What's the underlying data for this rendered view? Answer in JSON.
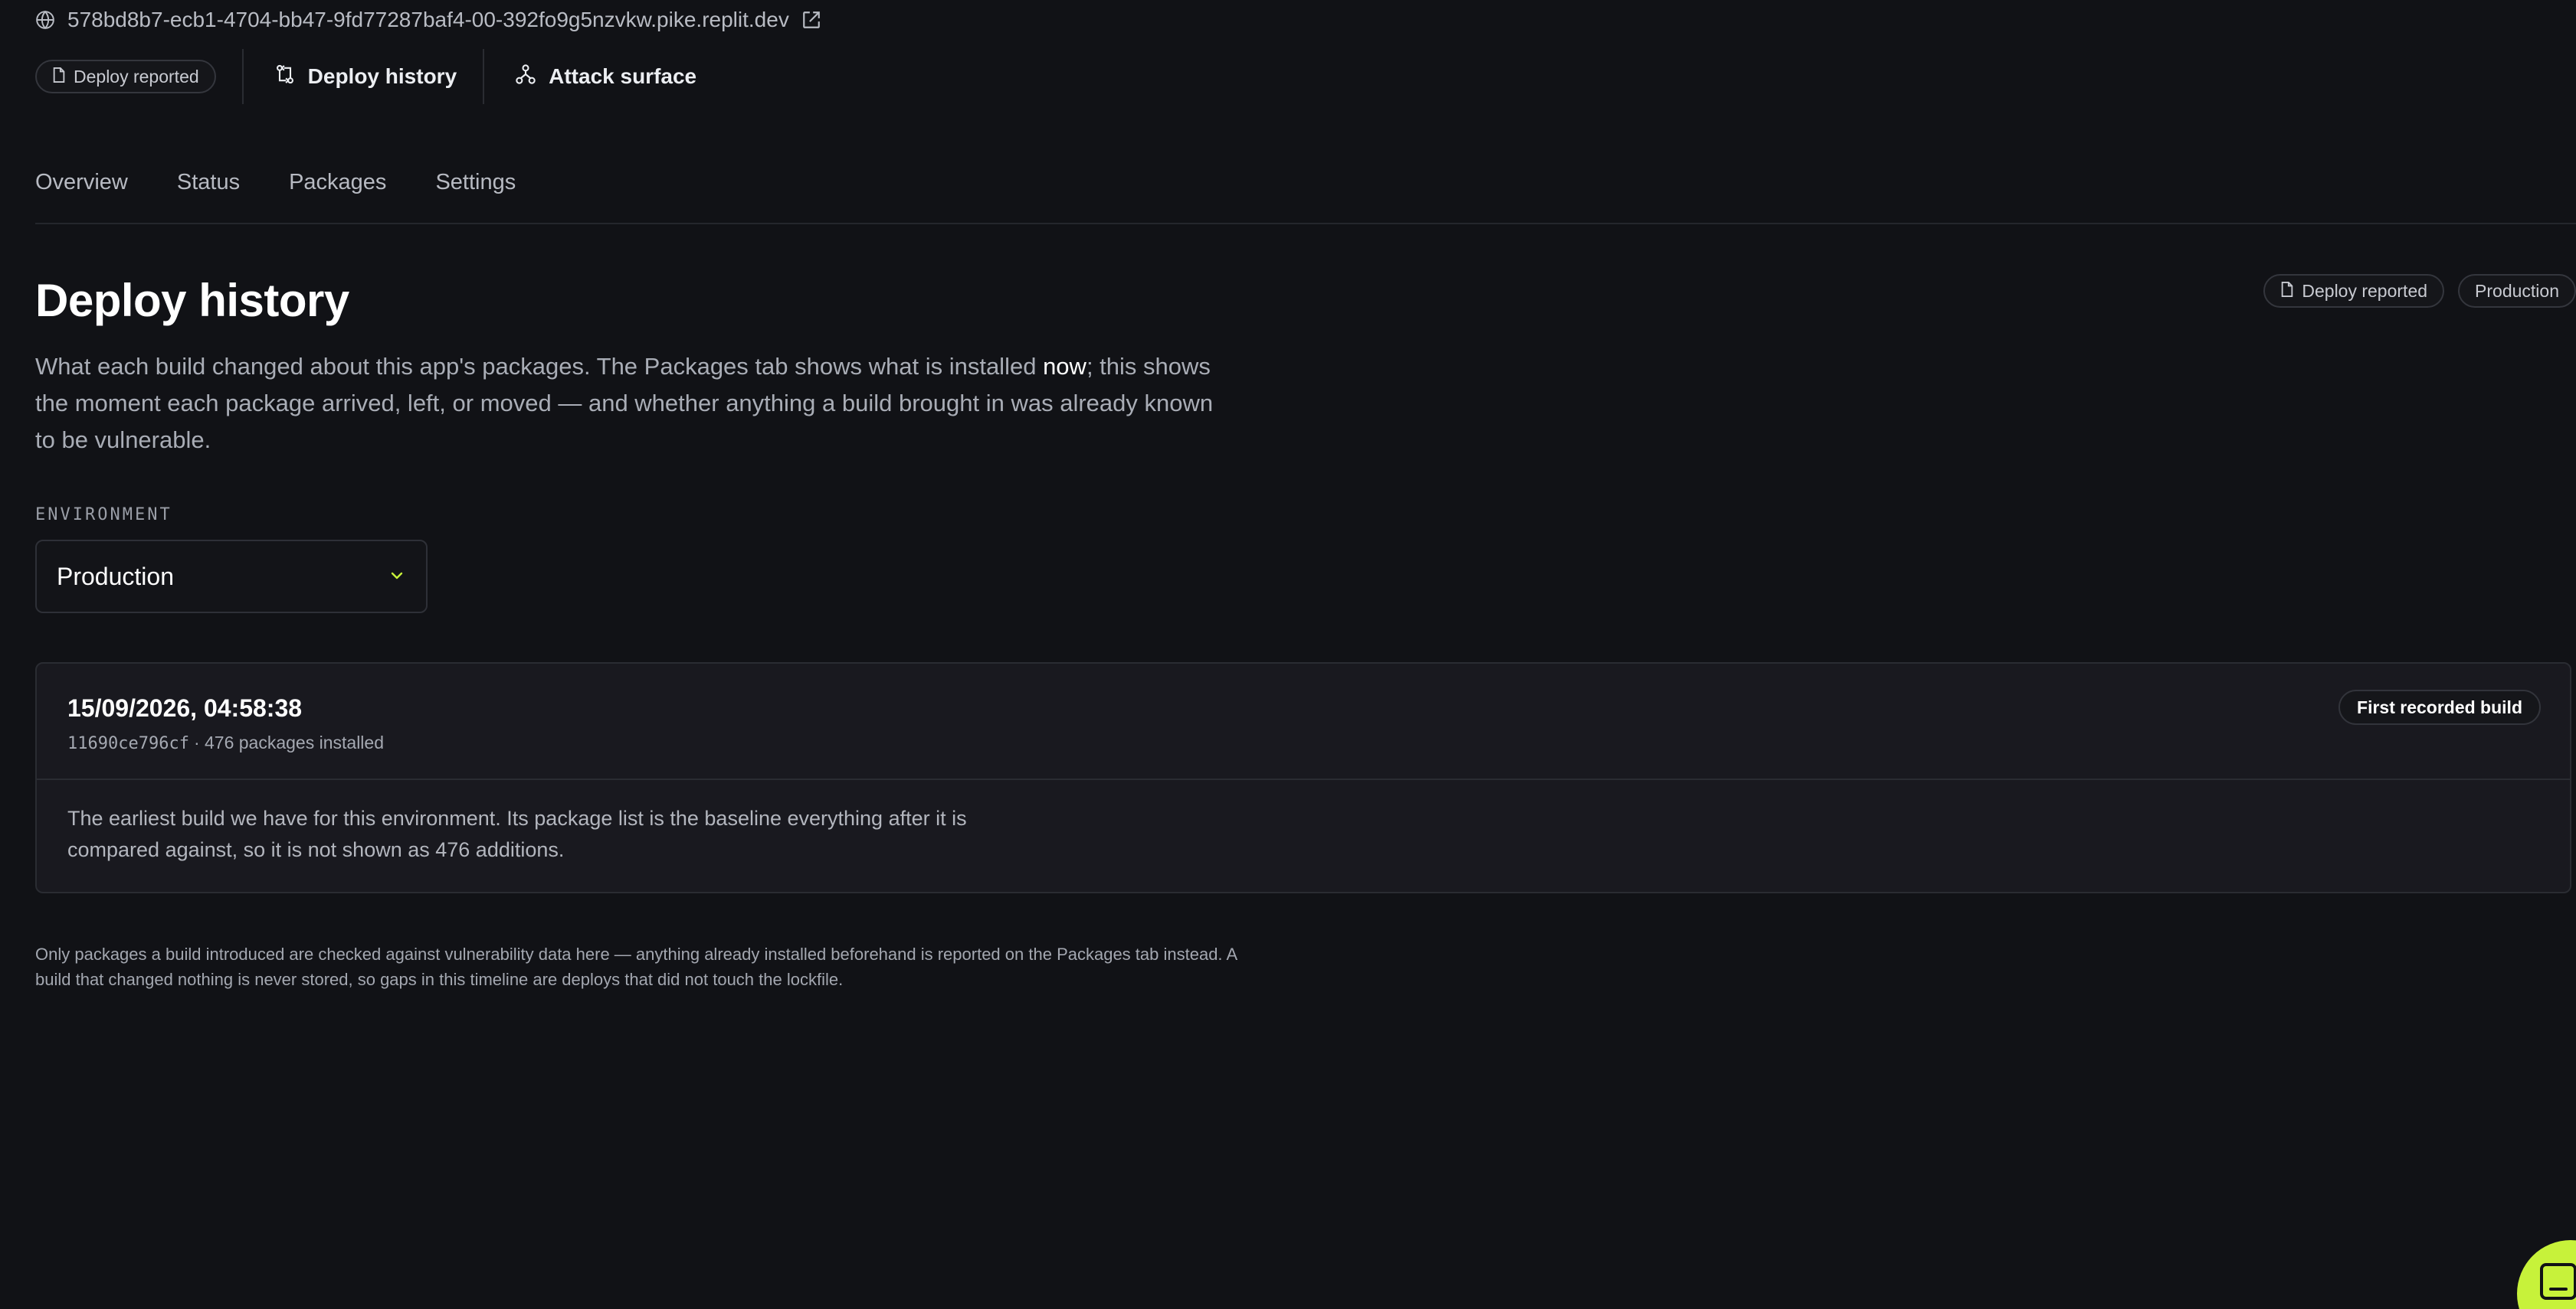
{
  "app_url": "578bd8b7-ecb1-4704-bb47-9fd77287baf4-00-392fo9g5nzvkw.pike.replit.dev",
  "actions": {
    "deploy_reported": "Deploy reported",
    "deploy_history": "Deploy history",
    "attack_surface": "Attack surface"
  },
  "tabs": [
    {
      "label": "Overview"
    },
    {
      "label": "Status"
    },
    {
      "label": "Packages"
    },
    {
      "label": "Settings"
    }
  ],
  "header": {
    "title": "Deploy history",
    "badge_deploy": "Deploy reported",
    "badge_env": "Production",
    "description_part1": "What each build changed about this app's packages. The Packages tab shows what is installed ",
    "description_highlight": "now",
    "description_part2": "; this shows the moment each package arrived, left, or moved — and whether anything a build brought in was already known to be vulnerable."
  },
  "environment": {
    "label": "ENVIRONMENT",
    "selected": "Production"
  },
  "build": {
    "timestamp": "15/09/2026, 04:58:38",
    "hash": "11690ce796cf",
    "packages": "· 476 packages installed",
    "badge": "First recorded build",
    "note": "The earliest build we have for this environment. Its package list is the baseline everything after it is compared against, so it is not shown as 476 additions."
  },
  "footnote": "Only packages a build introduced are checked against vulnerability data here — anything already installed beforehand is reported on the Packages tab instead. A build that changed nothing is never stored, so gaps in this timeline are deploys that did not touch the lockfile.",
  "colors": {
    "background": "#111216",
    "accent": "#c7f23a"
  }
}
